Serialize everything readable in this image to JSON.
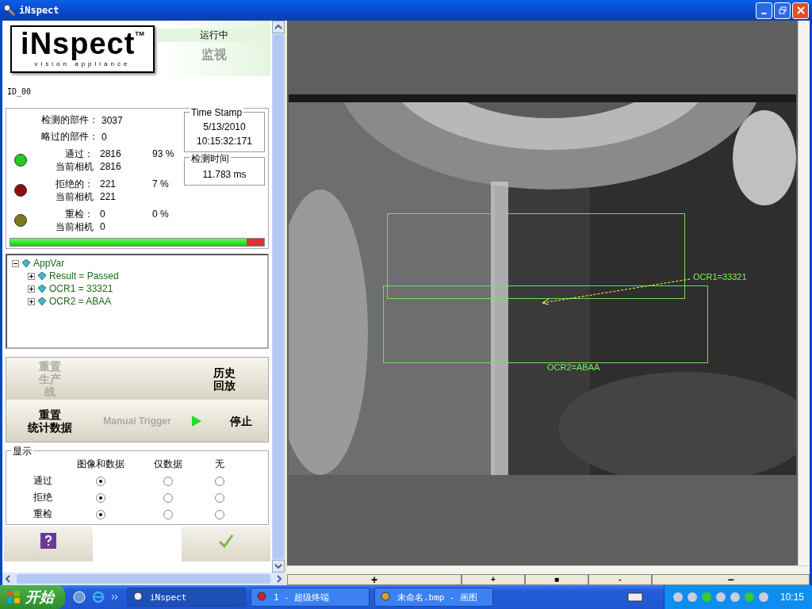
{
  "window": {
    "title": "iNspect"
  },
  "logo": {
    "name": "iNspect",
    "tm": "TM",
    "tagline": "vision appliance"
  },
  "status": {
    "state": "运行中",
    "mode": "监视"
  },
  "device_id": "ID_00",
  "counters": [
    {
      "label": "检测的部件：",
      "value": "3037"
    },
    {
      "label": "略过的部件：",
      "value": "0"
    }
  ],
  "results": [
    {
      "label": "通过：",
      "value": "2816",
      "percent": "93 %",
      "camera_label": "当前相机",
      "camera_value": "2816",
      "color": "#22cc22"
    },
    {
      "label": "拒绝的：",
      "value": "221",
      "percent": "7 %",
      "camera_label": "当前相机",
      "camera_value": "221",
      "color": "#8b1010"
    },
    {
      "label": "重检：",
      "value": "0",
      "percent": "0 %",
      "camera_label": "当前相机",
      "camera_value": "0",
      "color": "#7a7a20"
    }
  ],
  "time_stamp": {
    "title": "Time Stamp",
    "date": "5/13/2010",
    "time": "10:15:32:171"
  },
  "inspection_time": {
    "title": "检测时间",
    "value": "11.783 ms"
  },
  "ratio_bar": {
    "level": 0.93
  },
  "tree": {
    "label": "AppVar",
    "expanded": true,
    "children": [
      {
        "label": "Result = Passed",
        "expanded": false
      },
      {
        "label": "OCR1 = 33321",
        "expanded": false
      },
      {
        "label": "OCR2 = ABAA",
        "expanded": false
      }
    ]
  },
  "buttons": [
    {
      "kind": "text",
      "lines": [
        "重置",
        "生产",
        "线"
      ],
      "disabled": true
    },
    {
      "kind": "blank"
    },
    {
      "kind": "text",
      "lines": [
        "历史",
        "回放"
      ],
      "disabled": false
    },
    {
      "kind": "text",
      "lines": [
        "重置",
        "统计数据"
      ],
      "disabled": false
    },
    {
      "kind": "text",
      "lines": [
        "Manual Trigger"
      ],
      "disabled": true
    },
    {
      "kind": "play",
      "lines": [
        "停止"
      ],
      "disabled": false
    }
  ],
  "display": {
    "title": "显示",
    "columns": [
      "图像和数据",
      "仅数据",
      "无"
    ],
    "rows": [
      {
        "label": "通过",
        "options": [
          {
            "selected": true
          },
          {
            "selected": false
          },
          {
            "selected": false
          }
        ]
      },
      {
        "label": "拒绝",
        "options": [
          {
            "selected": true
          },
          {
            "selected": false
          },
          {
            "selected": false
          }
        ]
      },
      {
        "label": "重检",
        "options": [
          {
            "selected": true
          },
          {
            "selected": false
          },
          {
            "selected": false
          }
        ]
      }
    ]
  },
  "bottom_buttons": [
    {
      "kind": "help"
    },
    {
      "kind": "blank"
    },
    {
      "kind": "ok"
    }
  ],
  "image_view": {
    "overlays": [
      {
        "label": "OCR1=33321"
      },
      {
        "label": "OCR2=ABAA"
      }
    ]
  },
  "zoom_buttons": [
    "+",
    "+",
    "■",
    "-",
    "−"
  ],
  "taskbar": {
    "start": "开始",
    "tasks": [
      {
        "label": "iNspect",
        "selected": true
      },
      {
        "label": "1 - 超级终端",
        "selected": false
      },
      {
        "label": "未命名.bmp - 画图",
        "selected": false
      }
    ],
    "clock": "10:15"
  }
}
